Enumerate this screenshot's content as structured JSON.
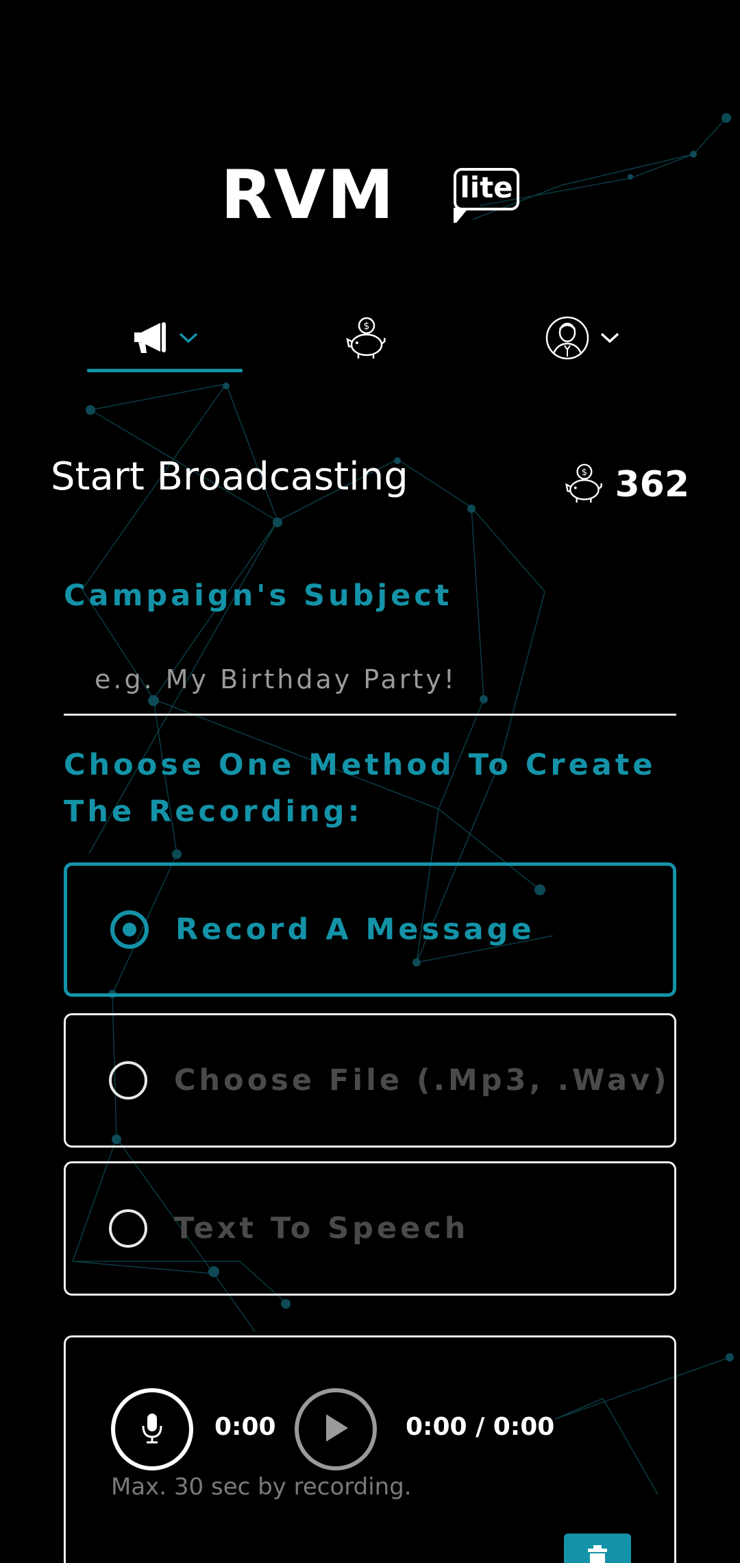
{
  "app": {
    "logo_text": "RVM",
    "logo_badge": "lite"
  },
  "nav": {
    "tabs": [
      {
        "icon": "megaphone-icon",
        "active": true,
        "has_dropdown": true
      },
      {
        "icon": "piggy-bank-icon",
        "active": false,
        "has_dropdown": false
      },
      {
        "icon": "user-avatar-icon",
        "active": false,
        "has_dropdown": true
      }
    ]
  },
  "header": {
    "title": "Start Broadcasting",
    "balance_icon": "piggy-bank-icon",
    "balance_value": "362"
  },
  "subject": {
    "label": "Campaign's Subject",
    "value": "",
    "placeholder": "e.g. My Birthday Party!"
  },
  "method": {
    "label": "Choose One Method To Create The Recording:",
    "options": [
      {
        "label": "Record A Message",
        "selected": true
      },
      {
        "label": "Choose File (.Mp3, .Wav)",
        "selected": false
      },
      {
        "label": "Text To Speech",
        "selected": false
      }
    ]
  },
  "recorder": {
    "record_time": "0:00",
    "playback_time": "0:00 / 0:00",
    "hint": "Max. 30 sec by recording."
  },
  "colors": {
    "accent": "#1493a8",
    "background": "#000000",
    "text": "#ffffff",
    "muted": "#4a4a4a"
  }
}
